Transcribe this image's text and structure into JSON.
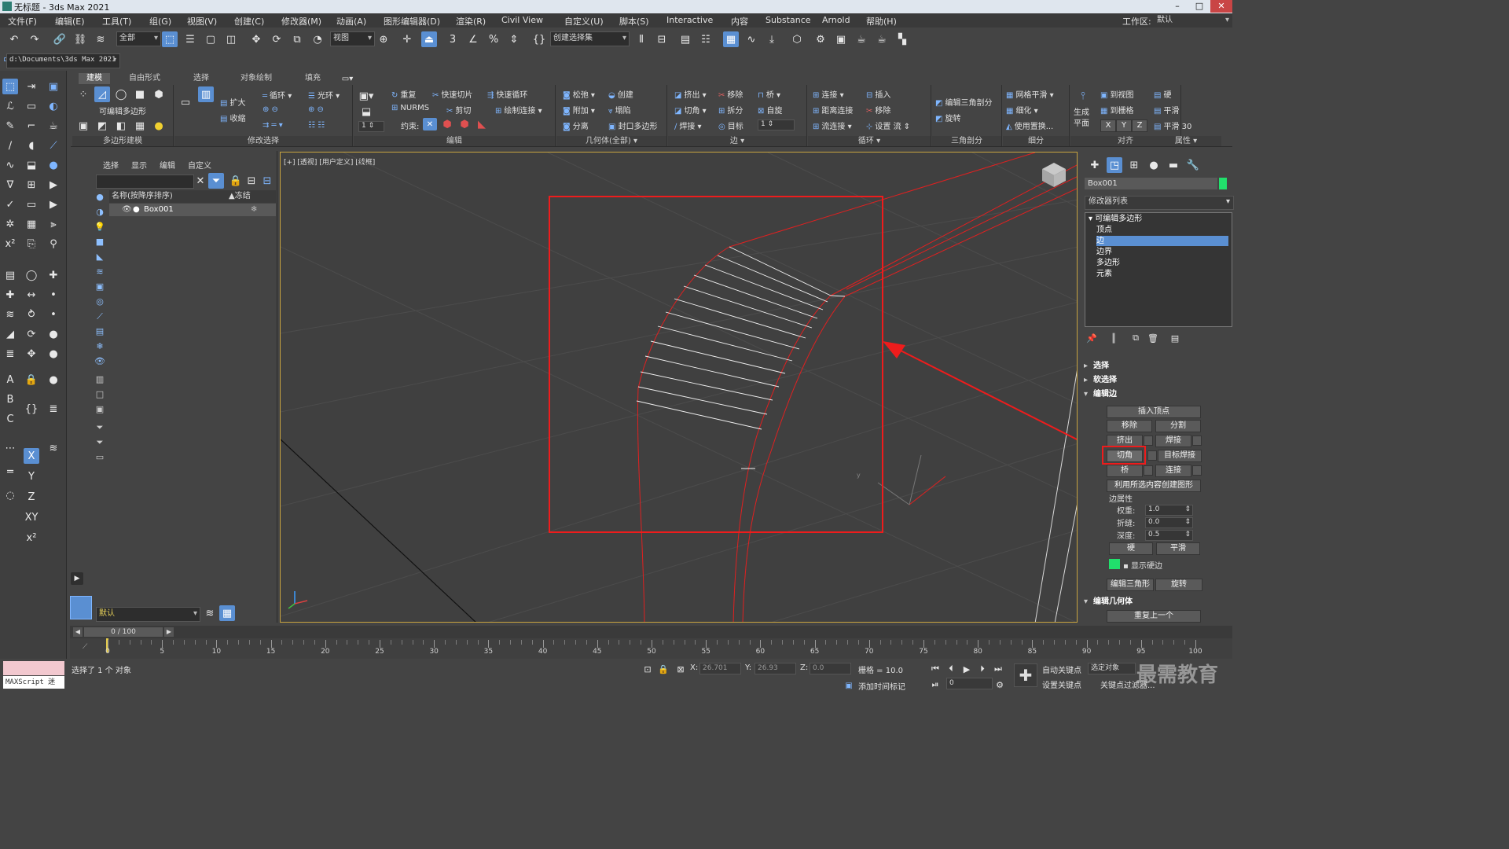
{
  "window": {
    "title": "无标题 - 3ds Max 2021",
    "controls": [
      "–",
      "□",
      "✕"
    ]
  },
  "menu": {
    "items": [
      "文件(F)",
      "编辑(E)",
      "工具(T)",
      "组(G)",
      "视图(V)",
      "创建(C)",
      "修改器(M)",
      "动画(A)",
      "图形编辑器(D)",
      "渲染(R)",
      "Civil View",
      "自定义(U)",
      "脚本(S)",
      "Interactive",
      "内容",
      "Substance",
      "Arnold",
      "帮助(H)"
    ],
    "workspace_label": "工作区:",
    "workspace_value": "默认"
  },
  "toolbar": {
    "selection_filter": "全部",
    "reference_coord": "视图",
    "named_selection": "创建选择集",
    "snap_value": "3"
  },
  "toolbar2": {
    "project_path": "d:\\Documents\\3ds Max 2021"
  },
  "ribbon": {
    "tabs": [
      "建模",
      "自由形式",
      "选择",
      "对象绘制",
      "填充"
    ],
    "active_tab": "建模",
    "panels": {
      "polymodel": "多边形建模",
      "polymodel_label": "可编辑多边形",
      "modsel": "修改选择",
      "grow": "扩大",
      "shrink": "收缩",
      "loop": "循环",
      "ring": "光环",
      "edit": "编辑",
      "repeat": "重复",
      "quickslice": "快速切片",
      "quickloop": "快速循环",
      "nurms": "NURMS",
      "cut": "剪切",
      "paintconnect": "绘制连接",
      "constraints": "约束:",
      "geometry": "几何体(全部)",
      "relax": "松弛",
      "create": "创建",
      "attach": "附加",
      "collapse": "塌陷",
      "detach": "分离",
      "cap": "封口多边形",
      "edges": "边",
      "extrude": "挤出",
      "remove": "移除",
      "bridge": "桥",
      "chamfer": "切角",
      "split": "拆分",
      "spin": "自旋",
      "weld": "焊接",
      "target": "目标",
      "spin_val": "1",
      "loops": "循环",
      "connect": "连接",
      "insert": "插入",
      "distconnect": "距离连接",
      "remove2": "移除",
      "flowconnect": "流连接",
      "setflow": "设置 流",
      "tris": "三角剖分",
      "edittri": "编辑三角剖分",
      "turn": "旋转",
      "subdiv": "细分",
      "meshsmooth": "网格平滑",
      "tessellate": "细化",
      "usedisp": "使用置换...",
      "generate": "生成",
      "plane": "平面",
      "align": "对齐",
      "toview": "到视图",
      "togrid": "到栅格",
      "xyz": [
        "X",
        "Y",
        "Z"
      ],
      "props": "属性",
      "hard": "硬",
      "smooth": "平滑",
      "smooth30": "平滑 30"
    }
  },
  "explorer": {
    "tabs": [
      "选择",
      "显示",
      "编辑",
      "自定义"
    ],
    "col_name": "名称(按降序排序)",
    "col_frozen": "▲冻结",
    "rows": [
      {
        "name": "Box001"
      }
    ],
    "layer": "默认"
  },
  "viewport": {
    "label": "[+] [透视] [用户定义] [线框]",
    "gizmo_axis_label": "y"
  },
  "command_panel": {
    "object_name": "Box001",
    "object_color": "#21e06c",
    "modifier_list": "修改器列表",
    "stack": {
      "root": "可编辑多边形",
      "items": [
        "顶点",
        "边",
        "边界",
        "多边形",
        "元素"
      ],
      "selected": "边"
    },
    "rollouts": {
      "select": "选择",
      "soft": "软选择",
      "edit_edges": "编辑边",
      "edit_geo": "编辑几何体"
    },
    "edit_edges": {
      "insert_vertex": "插入顶点",
      "remove": "移除",
      "split": "分割",
      "extrude": "挤出",
      "weld": "焊接",
      "chamfer": "切角",
      "target_weld": "目标焊接",
      "bridge": "桥",
      "connect": "连接",
      "create_shape": "利用所选内容创建图形",
      "edge_props": "边属性",
      "weight_label": "权重:",
      "weight": "1.0",
      "crease_label": "折缝:",
      "crease": "0.0",
      "depth_label": "深度:",
      "depth": "0.5",
      "hard": "硬",
      "smooth": "平滑",
      "show_hard": "显示硬边",
      "edit_tri": "编辑三角形",
      "turn": "旋转"
    },
    "edit_geo": {
      "repeat_last": "重复上一个"
    }
  },
  "timeline": {
    "frame": "0 / 100",
    "ticks": [
      0,
      5,
      10,
      15,
      20,
      25,
      30,
      35,
      40,
      45,
      50,
      55,
      60,
      65,
      70,
      75,
      80,
      85,
      90,
      95,
      100
    ]
  },
  "status": {
    "maxscript": "MAXScript 迷",
    "message": "选择了 1 个 对象",
    "x_label": "X:",
    "x": "26.701",
    "y_label": "Y:",
    "y": "26.93",
    "z_label": "Z:",
    "z": "0.0",
    "grid": "栅格 = 10.0",
    "add_time_tag": "添加时间标记",
    "auto_key": "自动关键点",
    "selected_obj": "选定对象",
    "set_key": "设置关键点",
    "key_filters": "关键点过滤器...",
    "frame_field": "0",
    "watermark": "最需教育"
  }
}
